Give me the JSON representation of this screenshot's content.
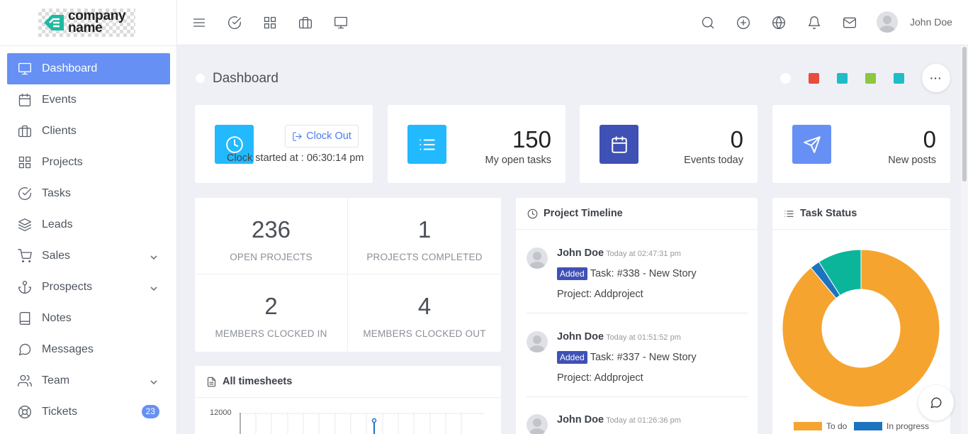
{
  "brand": {
    "logo_line1": "company",
    "logo_line2": "name"
  },
  "sidebar": {
    "items": [
      {
        "label": "Dashboard",
        "icon": "monitor-icon",
        "active": true
      },
      {
        "label": "Events",
        "icon": "calendar-icon"
      },
      {
        "label": "Clients",
        "icon": "briefcase-icon"
      },
      {
        "label": "Projects",
        "icon": "grid-icon"
      },
      {
        "label": "Tasks",
        "icon": "check-circle-icon"
      },
      {
        "label": "Leads",
        "icon": "layers-icon"
      },
      {
        "label": "Sales",
        "icon": "cart-icon",
        "has_submenu": true
      },
      {
        "label": "Prospects",
        "icon": "anchor-icon",
        "has_submenu": true
      },
      {
        "label": "Notes",
        "icon": "book-icon"
      },
      {
        "label": "Messages",
        "icon": "message-icon"
      },
      {
        "label": "Team",
        "icon": "users-icon",
        "has_submenu": true
      },
      {
        "label": "Tickets",
        "icon": "lifebuoy-icon",
        "badge": "23"
      }
    ]
  },
  "topbar": {
    "left_icons": [
      "menu-icon",
      "check-circle-icon",
      "grid-icon",
      "briefcase-icon",
      "monitor-icon"
    ],
    "right_icons": [
      "search-icon",
      "plus-circle-icon",
      "globe-icon",
      "bell-icon",
      "mail-icon"
    ],
    "user_name": "John Doe"
  },
  "page": {
    "title": "Dashboard",
    "color_swatches": [
      "#ffffff",
      "#e74c3c",
      "#1fbdc7",
      "#8dc63f",
      "#1fbdc7"
    ],
    "more_label": "···"
  },
  "clock_card": {
    "button_label": "Clock Out",
    "text": "Clock started at : 06:30:14 pm",
    "icon_color": "#22b9ff"
  },
  "stats": [
    {
      "value": "150",
      "label": "My open tasks",
      "icon": "list-icon",
      "color": "#22b9ff"
    },
    {
      "value": "0",
      "label": "Events today",
      "icon": "calendar-icon",
      "color": "#3f51b5"
    },
    {
      "value": "0",
      "label": "New posts",
      "icon": "send-icon",
      "color": "#6690f4"
    }
  ],
  "projects_summary": [
    {
      "value": "236",
      "label": "OPEN PROJECTS"
    },
    {
      "value": "1",
      "label": "PROJECTS COMPLETED"
    },
    {
      "value": "2",
      "label": "MEMBERS CLOCKED IN"
    },
    {
      "value": "4",
      "label": "MEMBERS CLOCKED OUT"
    }
  ],
  "timesheets": {
    "title": "All timesheets",
    "y_tick_top": "12000"
  },
  "timeline": {
    "title": "Project Timeline",
    "items": [
      {
        "name": "John Doe",
        "time": "Today at 02:47:31 pm",
        "tag": "Added",
        "task": "Task: #338 - New Story",
        "project": "Project: Addproject"
      },
      {
        "name": "John Doe",
        "time": "Today at 01:51:52 pm",
        "tag": "Added",
        "task": "Task: #337 - New Story",
        "project": "Project: Addproject"
      },
      {
        "name": "John Doe",
        "time": "Today at 01:26:36 pm"
      }
    ]
  },
  "task_status": {
    "title": "Task Status",
    "legend": [
      {
        "label": "To do",
        "color": "#f5a430"
      },
      {
        "label": "In progress",
        "color": "#1e73be"
      }
    ]
  },
  "chart_data": {
    "type": "pie",
    "title": "Task Status",
    "series": [
      {
        "name": "To do",
        "value": 89,
        "color": "#f5a430"
      },
      {
        "name": "In progress",
        "value": 2,
        "color": "#1e73be"
      },
      {
        "name": "",
        "value": 9,
        "color": "#0bb59a"
      }
    ],
    "donut": true
  }
}
